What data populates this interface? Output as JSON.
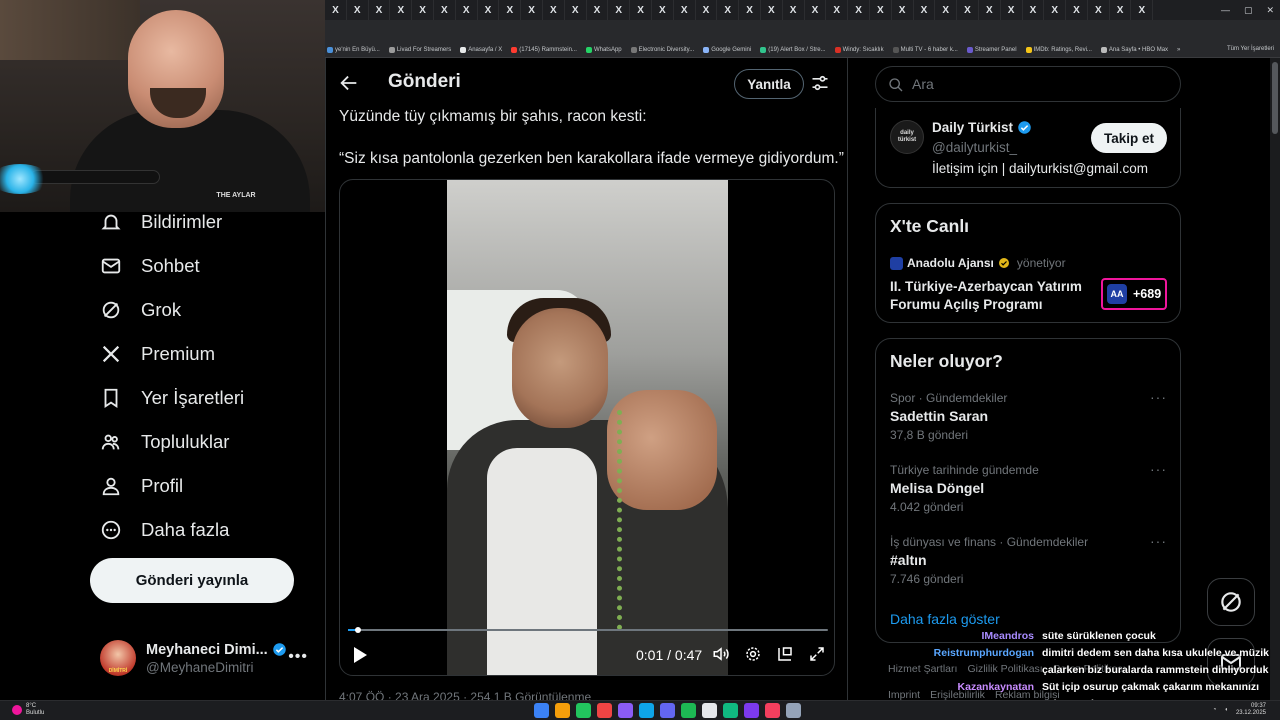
{
  "browser": {
    "tab_glyph": "X",
    "tab_count": 38,
    "bookmarks": [
      {
        "label": "ye'nin En Büyü...",
        "color": "#4a90d9"
      },
      {
        "label": "Livad For Streamers",
        "color": "#9b9b9b"
      },
      {
        "label": "Anasayfa / X",
        "color": "#e7e9ea"
      },
      {
        "label": "(17145) Rammstein...",
        "color": "#ff3b30"
      },
      {
        "label": "WhatsApp",
        "color": "#25d366"
      },
      {
        "label": "Electronic Diversity...",
        "color": "#777777"
      },
      {
        "label": "Google Gemini",
        "color": "#8ab4f8"
      },
      {
        "label": "(19) Alert Box / Stre...",
        "color": "#31c48d"
      },
      {
        "label": "Windy: Sıcaklık",
        "color": "#d93025"
      },
      {
        "label": "Multi TV - 6 haber k...",
        "color": "#555555"
      },
      {
        "label": "Streamer Panel",
        "color": "#6a5acd"
      },
      {
        "label": "IMDb: Ratings, Revi...",
        "color": "#f5c518"
      },
      {
        "label": "Ana Sayfa • HBO Max",
        "color": "#bbbbbb"
      }
    ],
    "bookmarks_more": "»",
    "all_bookmarks": "Tüm Yer İşaretleri"
  },
  "webcam": {
    "logo_text": "THE AYLAR"
  },
  "nav": {
    "items": [
      {
        "label": "Bildirimler",
        "icon": "bell-icon"
      },
      {
        "label": "Sohbet",
        "icon": "mail-icon"
      },
      {
        "label": "Grok",
        "icon": "grok-icon"
      },
      {
        "label": "Premium",
        "icon": "x-logo-icon"
      },
      {
        "label": "Yer İşaretleri",
        "icon": "bookmark-icon"
      },
      {
        "label": "Topluluklar",
        "icon": "communities-icon"
      },
      {
        "label": "Profil",
        "icon": "person-icon"
      },
      {
        "label": "Daha fazla",
        "icon": "more-circle-icon"
      }
    ],
    "post_button": "Gönderi yayınla"
  },
  "profile": {
    "name": "Meyhaneci Dimi...",
    "handle": "@MeyhaneDimitri",
    "avatar_text": "DİMİTRİ",
    "more": "•••"
  },
  "main": {
    "title": "Gönderi",
    "reply_button": "Yanıtla",
    "post_text_1": "Yüzünde tüy çıkmamış bir şahıs, racon kesti:",
    "post_text_2": "“Siz kısa pantolonla gezerken ben karakollara ifade vermeye gidiyordum.”",
    "video": {
      "time_display": "0:01 / 0:47",
      "progress": 0.021
    },
    "post_meta": "4:07 ÖÖ · 23 Ara 2025 · 254,1 B Görüntülenme"
  },
  "right": {
    "search_placeholder": "Ara",
    "profile_card": {
      "avatar_text": "daily türkist",
      "name": "Daily Türkist",
      "handle": "@dailyturkist_",
      "bio": "İletişim için | dailyturkist@gmail.com",
      "follow_button": "Takip et"
    },
    "live": {
      "title": "X'te Canlı",
      "host": "Anadolu Ajansı",
      "host_role": "yönetiyor",
      "event_title": "II. Türkiye-Azerbaycan Yatırım Forumu Açılış Programı",
      "listener_count": "+689",
      "badge_text": "AA"
    },
    "trends": {
      "title": "Neler oluyor?",
      "items": [
        {
          "category": "Spor · Gündemdekiler",
          "name": "Sadettin Saran",
          "count": "37,8 B gönderi"
        },
        {
          "category": "Türkiye tarihinde gündemde",
          "name": "Melisa Döngel",
          "count": "4.042 gönderi"
        },
        {
          "category": "İş dünyası ve finans · Gündemdekiler",
          "name": "#altın",
          "count": "7.746 gönderi"
        }
      ],
      "more_glyph": "···",
      "show_more": "Daha fazla göster"
    },
    "footer": {
      "line1": [
        "Hizmet Şartları",
        "Gizlilik Politikası",
        "Çerez Politikası"
      ],
      "line2": [
        "Imprint",
        "Erişilebilirlik",
        "Reklam bilgisi"
      ]
    }
  },
  "chat": [
    {
      "user": "IMeandros",
      "user_color": "#a98cff",
      "message": "süte sürüklenen çocuk"
    },
    {
      "user": "Reistrumphurdogan",
      "user_color": "#5aa7ff",
      "message": "dimitri dedem sen daha kısa ukulele ve müzik"
    },
    {
      "user": "",
      "user_color": "#ffffff",
      "message": "çalarken biz buralarda rammstein dinliyorduk"
    },
    {
      "user": "Kazankaynatan",
      "user_color": "#c88cff",
      "message": "Süt içip osurup çakmak çakarım mekanınızı"
    },
    {
      "user": "",
      "user_color": "#ffffff",
      "message": "yakarım ulen"
    }
  ],
  "taskbar": {
    "weather_temp": "8°C",
    "weather_desc": "Bulutlu",
    "time": "09:37",
    "date": "23.12.2025",
    "pinned_colors": [
      "#3b82f6",
      "#f59e0b",
      "#22c55e",
      "#ef4444",
      "#8b5cf6",
      "#0ea5e9",
      "#6366f1",
      "#1db954",
      "#e5e7eb",
      "#10b981",
      "#7c3aed",
      "#f43f5e",
      "#94a3b8"
    ]
  }
}
